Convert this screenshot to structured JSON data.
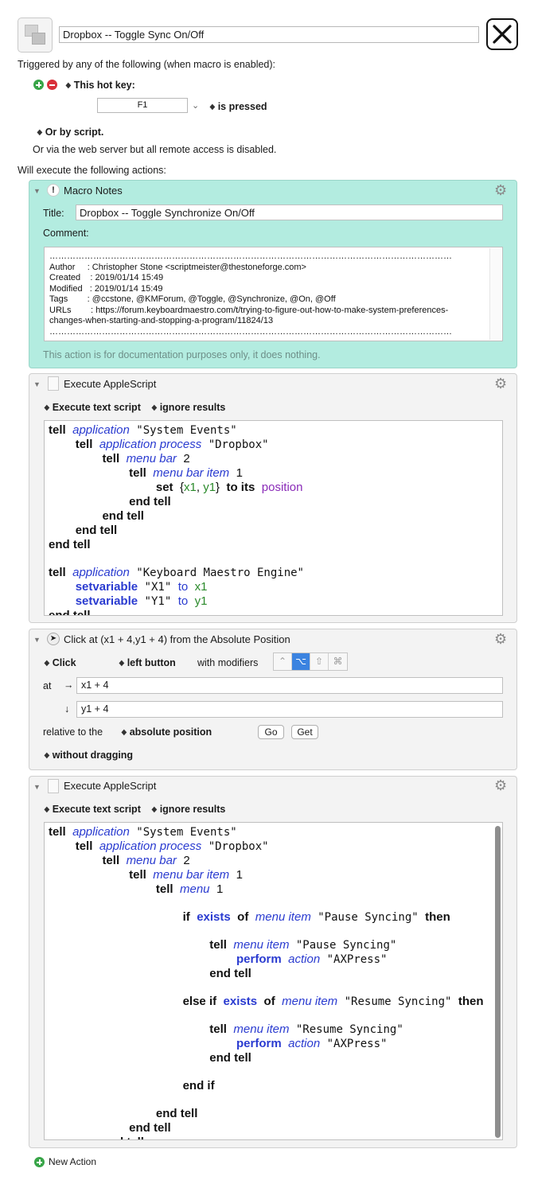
{
  "macro": {
    "name": "Dropbox -- Toggle Sync On/Off",
    "icon": "macro-icon",
    "close_icon": "close-x-icon"
  },
  "triggers": {
    "header": "Triggered by any of the following (when macro is enabled):",
    "hotkey_type": "This hot key:",
    "hotkey_value": "F1",
    "hotkey_condition": "is pressed",
    "or_by_script": "Or by script.",
    "web_server": "Or via the web server but all remote access is disabled."
  },
  "actions_header": "Will execute the following actions:",
  "notes": {
    "title": "Macro Notes",
    "title_label": "Title:",
    "title_value": "Dropbox -- Toggle Synchronize On/Off",
    "comment_label": "Comment:",
    "comment_text": "…………………………………………………………………………………………………………………………\nAuthor     : Christopher Stone <scriptmeister@thestoneforge.com>\nCreated    : 2019/01/14 15:49\nModified   : 2019/01/14 15:49\nTags        : @ccstone, @KMForum, @Toggle, @Synchronize, @On, @Off\nURLs        : https://forum.keyboardmaestro.com/t/trying-to-figure-out-how-to-make-system-preferences-\nchanges-when-starting-and-stopping-a-program/11824/13\n…………………………………………………………………………………………………………………………",
    "footer": "This action is for documentation purposes only, it does nothing."
  },
  "applescript1": {
    "title": "Execute AppleScript",
    "mode": "Execute text script",
    "results": "ignore results"
  },
  "click_action": {
    "title": "Click at (x1 + 4,y1 + 4) from the Absolute Position",
    "click_type": "Click",
    "button": "left button",
    "modifiers_label": "with modifiers",
    "modifiers": [
      "⌃",
      "⌥",
      "⇧",
      "⌘"
    ],
    "active_modifier_index": 1,
    "at_label": "at",
    "right_arrow": "→",
    "down_arrow": "↓",
    "x_expr": "x1 + 4",
    "y_expr": "y1 + 4",
    "relative_label": "relative to the",
    "relative_value": "absolute position",
    "go": "Go",
    "get": "Get",
    "dragging": "without dragging"
  },
  "applescript2": {
    "title": "Execute AppleScript",
    "mode": "Execute text script",
    "results": "ignore results"
  },
  "new_action": "New Action"
}
